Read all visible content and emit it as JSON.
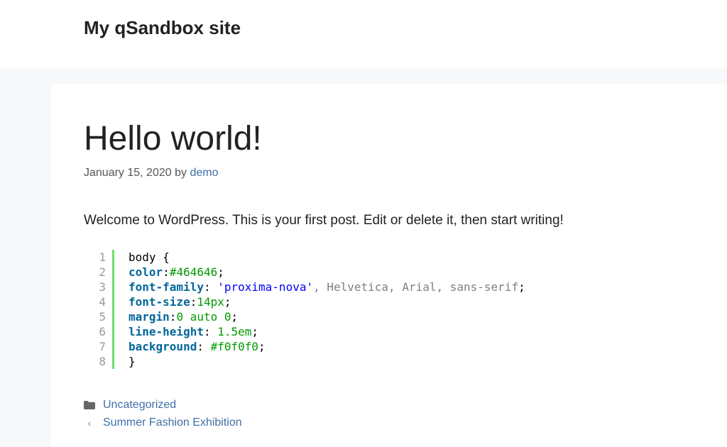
{
  "header": {
    "site_title": "My qSandbox site"
  },
  "post": {
    "title": "Hello world!",
    "meta": {
      "date": "January 15, 2020",
      "by": " by ",
      "author": "demo"
    },
    "body": "Welcome to WordPress. This is your first post. Edit or delete it, then start writing!"
  },
  "code": {
    "lines": [
      {
        "num": "1",
        "tokens": [
          {
            "t": "body {",
            "c": "plain"
          }
        ]
      },
      {
        "num": "2",
        "tokens": [
          {
            "t": "color",
            "c": "prop"
          },
          {
            "t": ":",
            "c": "plain"
          },
          {
            "t": "#464646",
            "c": "val"
          },
          {
            "t": ";",
            "c": "plain"
          }
        ]
      },
      {
        "num": "3",
        "tokens": [
          {
            "t": "font-family",
            "c": "prop"
          },
          {
            "t": ": ",
            "c": "plain"
          },
          {
            "t": "'proxima-nova'",
            "c": "str"
          },
          {
            "t": ", Helvetica, Arial, sans-serif",
            "c": "muted"
          },
          {
            "t": ";",
            "c": "plain"
          }
        ]
      },
      {
        "num": "4",
        "tokens": [
          {
            "t": "font-size",
            "c": "prop"
          },
          {
            "t": ":",
            "c": "plain"
          },
          {
            "t": "14px",
            "c": "val"
          },
          {
            "t": ";",
            "c": "plain"
          }
        ]
      },
      {
        "num": "5",
        "tokens": [
          {
            "t": "margin",
            "c": "prop"
          },
          {
            "t": ":",
            "c": "plain"
          },
          {
            "t": "0 auto 0",
            "c": "val"
          },
          {
            "t": ";",
            "c": "plain"
          }
        ]
      },
      {
        "num": "6",
        "tokens": [
          {
            "t": "line-height",
            "c": "prop"
          },
          {
            "t": ": ",
            "c": "plain"
          },
          {
            "t": "1.5em",
            "c": "val"
          },
          {
            "t": ";",
            "c": "plain"
          }
        ]
      },
      {
        "num": "7",
        "tokens": [
          {
            "t": "background",
            "c": "prop"
          },
          {
            "t": ": ",
            "c": "plain"
          },
          {
            "t": "#f0f0f0",
            "c": "val"
          },
          {
            "t": ";",
            "c": "plain"
          }
        ]
      },
      {
        "num": "8",
        "tokens": [
          {
            "t": "}",
            "c": "plain"
          }
        ]
      }
    ]
  },
  "footer": {
    "category_icon": "folder-icon",
    "category": "Uncategorized",
    "prev_icon": "chevron-left-icon",
    "prev_post": "Summer Fashion Exhibition"
  },
  "colors": {
    "link": "#3f6fa6",
    "code_gutter_border": "#6ce26c",
    "page_bg": "#f7f8f9"
  }
}
